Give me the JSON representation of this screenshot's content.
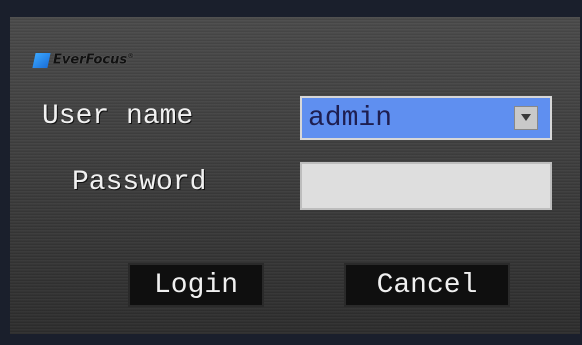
{
  "logo": {
    "text": "EverFocus",
    "mark": "®",
    "accent": "#1b6fd8"
  },
  "form": {
    "user_label": "User name",
    "user_value": "admin",
    "password_label": "Password",
    "password_value": ""
  },
  "buttons": {
    "login_label": "Login",
    "cancel_label": "Cancel"
  },
  "icons": {
    "dropdown": "chevron-down-icon"
  },
  "colors": {
    "selected_field": "#5f8ff0",
    "input_field": "#dedede"
  }
}
